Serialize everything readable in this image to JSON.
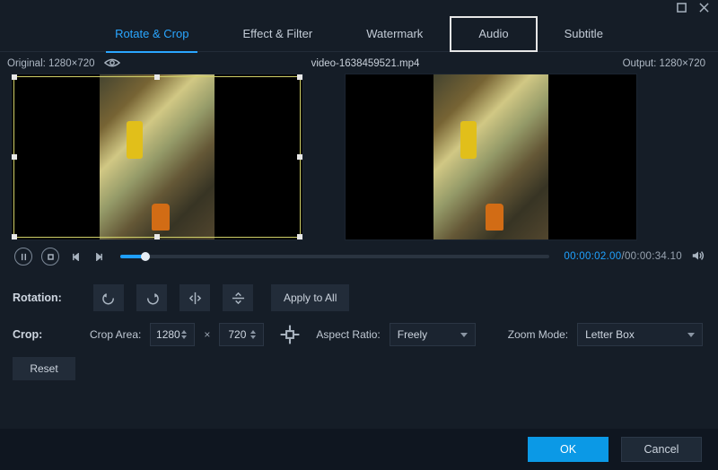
{
  "window": {
    "title": "video-1638459521.mp4"
  },
  "tabs": [
    {
      "label": "Rotate & Crop",
      "active": true,
      "highlighted": false
    },
    {
      "label": "Effect & Filter",
      "active": false,
      "highlighted": false
    },
    {
      "label": "Watermark",
      "active": false,
      "highlighted": false
    },
    {
      "label": "Audio",
      "active": false,
      "highlighted": true
    },
    {
      "label": "Subtitle",
      "active": false,
      "highlighted": false
    }
  ],
  "info": {
    "original_label": "Original: 1280×720",
    "filename": "video-1638459521.mp4",
    "output_label": "Output: 1280×720"
  },
  "playback": {
    "current": "00:00:02.00",
    "total": "00:00:34.10",
    "separator": "/",
    "progress_percent": 5.8
  },
  "rotation": {
    "label": "Rotation:",
    "apply_all_label": "Apply to All"
  },
  "crop": {
    "label": "Crop:",
    "area_label": "Crop Area:",
    "width": "1280",
    "height": "720",
    "multiply": "×",
    "aspect_label": "Aspect Ratio:",
    "aspect_value": "Freely",
    "zoom_label": "Zoom Mode:",
    "zoom_value": "Letter Box",
    "reset_label": "Reset"
  },
  "footer": {
    "ok": "OK",
    "cancel": "Cancel"
  }
}
